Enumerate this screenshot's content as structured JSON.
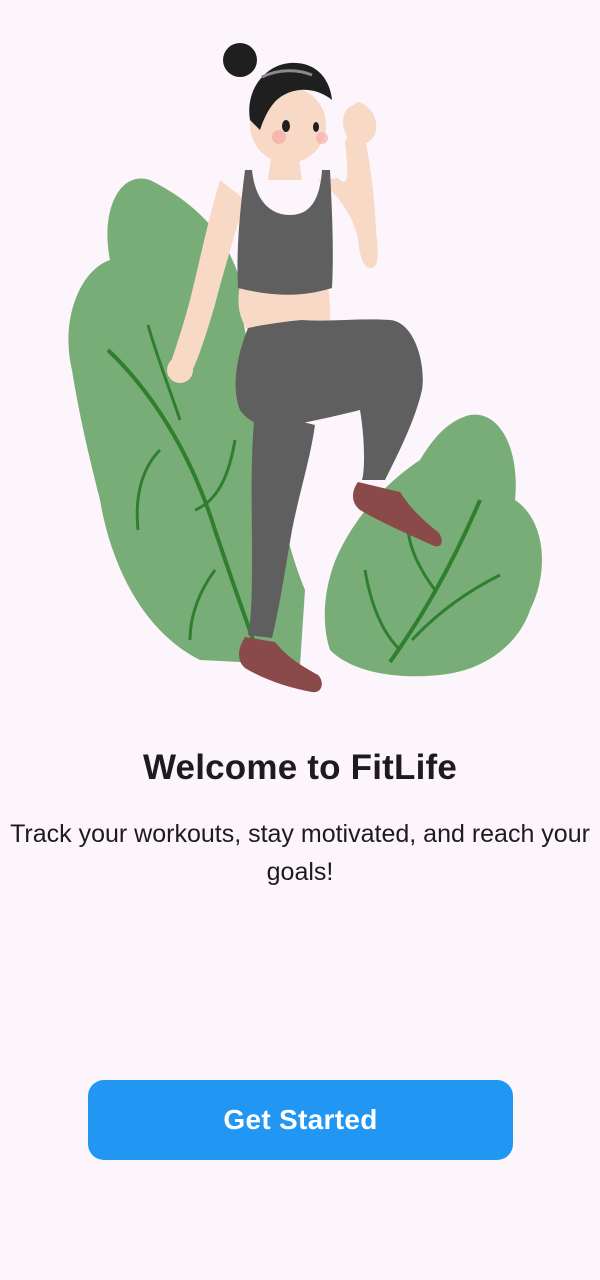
{
  "welcome": {
    "title": "Welcome to FitLife",
    "subtitle": "Track your workouts, stay motivated, and reach your goals!"
  },
  "actions": {
    "get_started_label": "Get Started"
  },
  "illustration": {
    "icon": "woman-exercising-illustration"
  },
  "colors": {
    "background": "#fcf5fc",
    "primary": "#2196f3",
    "leaf": "#79ad78",
    "leaf_vein": "#2f7f2f",
    "outfit": "#5f5f5f",
    "shoes": "#8a4a4a",
    "text": "#1d1b20"
  }
}
